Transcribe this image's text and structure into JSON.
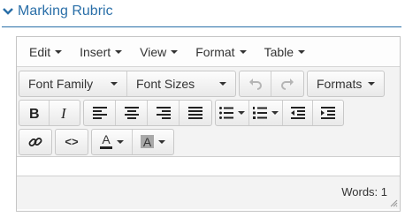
{
  "header": {
    "title": "Marking Rubric"
  },
  "menubar": {
    "items": [
      {
        "label": "Edit"
      },
      {
        "label": "Insert"
      },
      {
        "label": "View"
      },
      {
        "label": "Format"
      },
      {
        "label": "Table"
      }
    ]
  },
  "toolbar": {
    "font_family_label": "Font Family",
    "font_sizes_label": "Font Sizes",
    "formats_label": "Formats",
    "text_color_letter": "A",
    "bg_color_letter": "A",
    "code_symbol": "<>"
  },
  "statusbar": {
    "words_text": "Words: 1"
  },
  "colors": {
    "accent": "#2a6fa8",
    "border": "#c5c5c5",
    "toolbar_bg": "#f3f3f3"
  }
}
